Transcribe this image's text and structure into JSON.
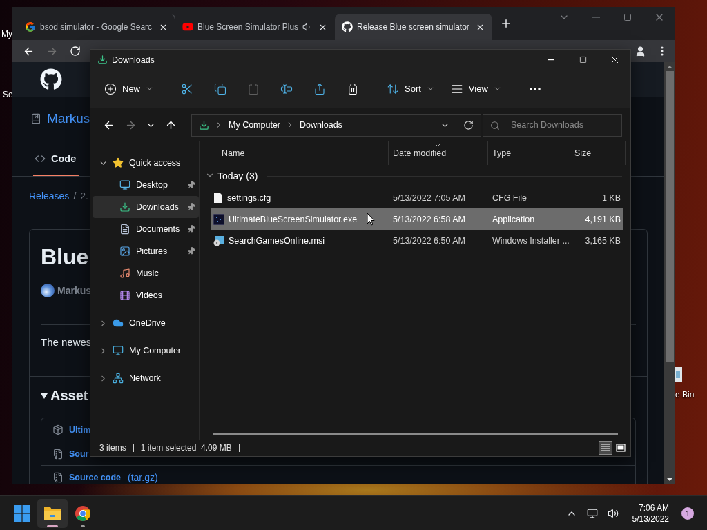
{
  "desktop": {
    "icons": [
      {
        "label": "My"
      },
      {
        "label": "Se"
      },
      {
        "label": "e Bin"
      }
    ]
  },
  "browser": {
    "tabs": [
      {
        "title": "bsod simulator - Google Searc",
        "kind": "google",
        "audio": false,
        "selected": false
      },
      {
        "title": "Blue Screen Simulator Plus",
        "kind": "youtube",
        "audio": true,
        "selected": false
      },
      {
        "title": "Release Blue screen simulator",
        "kind": "github",
        "audio": false,
        "selected": true
      }
    ],
    "nav_buttons": [
      {
        "kind": "back",
        "disabled": false
      },
      {
        "kind": "forward",
        "disabled": true
      },
      {
        "kind": "reload",
        "disabled": false
      }
    ],
    "page": {
      "repo": "Markus",
      "tabs": [
        {
          "label": "Code",
          "selected": true
        }
      ],
      "breadcrumb": {
        "link": "Releases",
        "separator": "/",
        "current": "2."
      },
      "release_title": "Blue",
      "author": "Markus",
      "description": "The newes",
      "assets_heading": "Asset",
      "assets": [
        {
          "kind": "package",
          "name": "Ultim"
        },
        {
          "kind": "archive",
          "name": "Sour"
        },
        {
          "kind": "archive",
          "name": "Source code",
          "format": "(tar.gz)"
        }
      ]
    }
  },
  "explorer": {
    "title": "Downloads",
    "toolbar": [
      {
        "kind": "new",
        "label": "New",
        "disabled": false
      },
      {
        "kind": "cut",
        "disabled": false
      },
      {
        "kind": "copy",
        "disabled": false
      },
      {
        "kind": "paste",
        "disabled": true
      },
      {
        "kind": "rename",
        "disabled": false
      },
      {
        "kind": "share",
        "disabled": false
      },
      {
        "kind": "delete",
        "disabled": false
      },
      {
        "kind": "sort",
        "label": "Sort",
        "disabled": false
      },
      {
        "kind": "view",
        "label": "View",
        "disabled": false
      },
      {
        "kind": "more",
        "disabled": false
      }
    ],
    "nav_buttons": [
      {
        "kind": "back",
        "disabled": false
      },
      {
        "kind": "forward",
        "disabled": true
      },
      {
        "kind": "recent",
        "disabled": false
      },
      {
        "kind": "up",
        "disabled": false
      }
    ],
    "path": [
      "My Computer",
      "Downloads"
    ],
    "search": {
      "placeholder": "Search Downloads"
    },
    "nav": [
      {
        "label": "Quick access",
        "kind": "star",
        "expanded": true,
        "selected": false,
        "children": [
          {
            "label": "Desktop",
            "kind": "desktop",
            "pinned": true,
            "selected": false
          },
          {
            "label": "Downloads",
            "kind": "download",
            "pinned": true,
            "selected": true
          },
          {
            "label": "Documents",
            "kind": "document",
            "pinned": true,
            "selected": false
          },
          {
            "label": "Pictures",
            "kind": "picture",
            "pinned": true,
            "selected": false
          },
          {
            "label": "Music",
            "kind": "music",
            "pinned": false,
            "selected": false
          },
          {
            "label": "Videos",
            "kind": "video",
            "pinned": false,
            "selected": false
          }
        ]
      },
      {
        "label": "OneDrive",
        "kind": "cloud",
        "expanded": false,
        "selected": false
      },
      {
        "label": "My Computer",
        "kind": "computer",
        "expanded": false,
        "selected": false
      },
      {
        "label": "Network",
        "kind": "network",
        "expanded": false,
        "selected": false
      }
    ],
    "columns": [
      {
        "label": "Name",
        "sorted": false
      },
      {
        "label": "Date modified",
        "sorted": true
      },
      {
        "label": "Type",
        "sorted": false
      },
      {
        "label": "Size",
        "sorted": false
      }
    ],
    "group": {
      "label": "Today (3)",
      "expanded": true
    },
    "files": [
      {
        "name": "settings.cfg",
        "kind": "file",
        "date": "5/13/2022 7:05 AM",
        "type": "CFG File",
        "size": "1 KB",
        "selected": false
      },
      {
        "name": "UltimateBlueScreenSimulator.exe",
        "kind": "app",
        "date": "5/13/2022 6:58 AM",
        "type": "Application",
        "size": "4,191 KB",
        "selected": true
      },
      {
        "name": "SearchGamesOnline.msi",
        "kind": "installer",
        "date": "5/13/2022 6:50 AM",
        "type": "Windows Installer ...",
        "size": "3,165 KB",
        "selected": false
      }
    ],
    "status": [
      "3 items",
      "1 item selected  4.09 MB"
    ],
    "view_modes": [
      {
        "kind": "details",
        "selected": true
      },
      {
        "kind": "tiles",
        "selected": false
      }
    ]
  },
  "taskbar": {
    "apps": [
      {
        "kind": "start",
        "active": false
      },
      {
        "kind": "explorer",
        "active": true
      },
      {
        "kind": "chrome",
        "active": false
      }
    ],
    "time": "7:06 AM",
    "date": "5/13/2022",
    "notifications": "1"
  }
}
